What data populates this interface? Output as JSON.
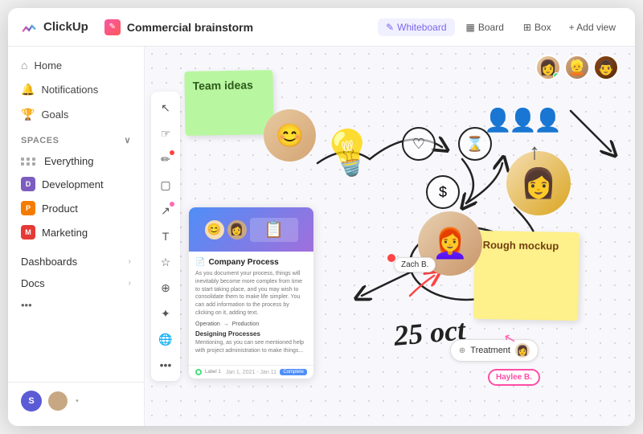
{
  "app": {
    "name": "ClickUp"
  },
  "topbar": {
    "page_title": "Commercial brainstorm",
    "page_icon": "✏️",
    "views": [
      {
        "id": "whiteboard",
        "label": "Whiteboard",
        "icon": "✏️",
        "active": true
      },
      {
        "id": "board",
        "label": "Board",
        "icon": "▦"
      },
      {
        "id": "box",
        "label": "Box",
        "icon": "⊞"
      }
    ],
    "add_view_label": "+ Add view"
  },
  "sidebar": {
    "nav_items": [
      {
        "id": "home",
        "label": "Home",
        "icon": "⌂"
      },
      {
        "id": "notifications",
        "label": "Notifications",
        "icon": "🔔"
      },
      {
        "id": "goals",
        "label": "Goals",
        "icon": "🏆"
      }
    ],
    "spaces_label": "Spaces",
    "spaces": [
      {
        "id": "everything",
        "label": "Everything",
        "type": "grid"
      },
      {
        "id": "development",
        "label": "Development",
        "type": "dot",
        "color": "#7c5cbf",
        "letter": "D"
      },
      {
        "id": "product",
        "label": "Product",
        "type": "dot",
        "color": "#f57c00",
        "letter": "P"
      },
      {
        "id": "marketing",
        "label": "Marketing",
        "type": "dot",
        "color": "#e53935",
        "letter": "M"
      }
    ],
    "extra_items": [
      {
        "id": "dashboards",
        "label": "Dashboards"
      },
      {
        "id": "docs",
        "label": "Docs"
      }
    ],
    "more_label": "•••",
    "user_initial": "S"
  },
  "toolbar": {
    "tools": [
      {
        "id": "cursor",
        "icon": "↖",
        "has_dot": false
      },
      {
        "id": "hand",
        "icon": "☞",
        "has_dot": false
      },
      {
        "id": "pencil",
        "icon": "✏",
        "has_dot": true,
        "dot_color": "red"
      },
      {
        "id": "square",
        "icon": "▢",
        "has_dot": false
      },
      {
        "id": "arrow",
        "icon": "↗",
        "has_dot": true,
        "dot_color": "pink"
      },
      {
        "id": "text",
        "icon": "T",
        "has_dot": false
      },
      {
        "id": "sticky",
        "icon": "☆",
        "has_dot": false
      },
      {
        "id": "connect",
        "icon": "⊕",
        "has_dot": false
      },
      {
        "id": "magic",
        "icon": "✦",
        "has_dot": false
      },
      {
        "id": "globe",
        "icon": "🌐",
        "has_dot": false
      },
      {
        "id": "more",
        "icon": "•••",
        "has_dot": false
      }
    ]
  },
  "canvas": {
    "sticky_green": {
      "text": "Team ideas"
    },
    "sticky_yellow": {
      "text": "Rough mockup"
    },
    "document": {
      "title": "Company Process",
      "section": "Designing Processes",
      "status_left": "Operation",
      "status_right": "Production"
    },
    "tags": {
      "zach": "Zach B.",
      "haylee": "Haylee B.",
      "treatment": "Treatment"
    },
    "date": "25 oct",
    "avatars": [
      "A1",
      "A2",
      "A3"
    ]
  },
  "icons": {
    "heart": "♡",
    "hourglass": "⌛",
    "dollar": "$",
    "people": "👥",
    "up_arrow": "↑"
  }
}
